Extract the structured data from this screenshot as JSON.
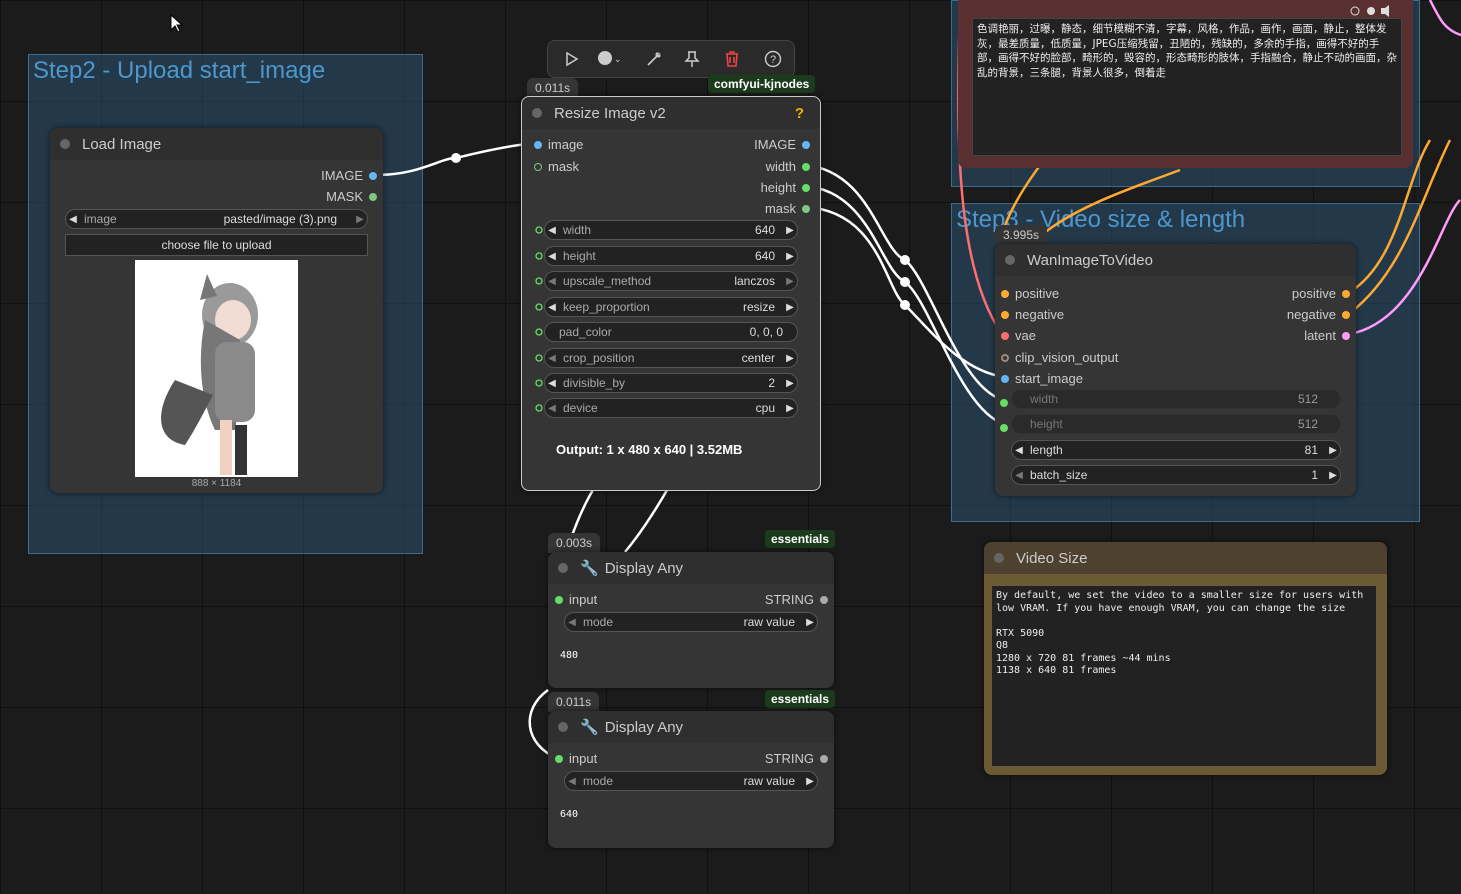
{
  "groups": {
    "step2": "Step2 - Upload start_image",
    "step3": "Step3 - Video size & length"
  },
  "toolbar": {
    "icons": [
      "play-icon",
      "circle-dropdown-icon",
      "wand-icon",
      "pin-icon",
      "trash-icon",
      "help-icon"
    ]
  },
  "load_image": {
    "title": "Load Image",
    "outputs": [
      "IMAGE",
      "MASK"
    ],
    "image_label": "image",
    "image_value": "pasted/image (3).png",
    "upload_label": "choose file to upload",
    "dims": "888 × 1184"
  },
  "resize": {
    "time": "0.011s",
    "source": "comfyui-kjnodes",
    "title": "Resize Image v2",
    "help": "?",
    "inputs": [
      "image",
      "mask"
    ],
    "outputs": [
      "IMAGE",
      "width",
      "height",
      "mask"
    ],
    "widgets": [
      {
        "label": "width",
        "value": "640"
      },
      {
        "label": "height",
        "value": "640"
      },
      {
        "label": "upscale_method",
        "value": "lanczos"
      },
      {
        "label": "keep_proportion",
        "value": "resize"
      },
      {
        "label": "pad_color",
        "value": "0, 0, 0"
      },
      {
        "label": "crop_position",
        "value": "center"
      },
      {
        "label": "divisible_by",
        "value": "2"
      },
      {
        "label": "device",
        "value": "cpu"
      }
    ],
    "output_text": "Output: 1 x 480 x 640 | 3.52MB"
  },
  "display1": {
    "time": "0.003s",
    "tag": "essentials",
    "title": "Display Any",
    "input": "input",
    "output": "STRING",
    "mode_label": "mode",
    "mode_value": "raw value",
    "value": "480"
  },
  "display2": {
    "time": "0.011s",
    "tag": "essentials",
    "title": "Display Any",
    "input": "input",
    "output": "STRING",
    "mode_label": "mode",
    "mode_value": "raw value",
    "value": "640"
  },
  "wan": {
    "time": "3.995s",
    "title": "WanImageToVideo",
    "inputs": [
      "positive",
      "negative",
      "vae",
      "clip_vision_output",
      "start_image"
    ],
    "outputs": [
      "positive",
      "negative",
      "latent"
    ],
    "widgets": [
      {
        "label": "width",
        "value": "512"
      },
      {
        "label": "height",
        "value": "512"
      },
      {
        "label": "length",
        "value": "81"
      },
      {
        "label": "batch_size",
        "value": "1"
      }
    ]
  },
  "neg_prompt": {
    "text": "色调艳丽，过曝，静态，细节模糊不清，字幕，风格，作品，画作，画面，静止，整体发灰，最差质量，低质量，JPEG压缩残留，丑陋的，残缺的，多余的手指，画得不好的手部，画得不好的脸部，畸形的，毁容的，形态畸形的肢体，手指融合，静止不动的画面，杂乱的背景，三条腿，背景人很多，倒着走"
  },
  "video_size": {
    "title": "Video Size",
    "note": "By default, we set the video to a smaller size for users with\nlow VRAM. If you have enough VRAM, you can change the size\n\nRTX 5090\nQ8\n1280 x 720 81 frames ~44 mins\n1138 x 640 81 frames"
  },
  "colors": {
    "image": "#64b5f6",
    "mask": "#81c784",
    "int": "#66dd66",
    "cond": "#ffa931",
    "vae": "#ff6e6e",
    "latent": "#ff9cf9",
    "clip": "#a1887f"
  }
}
